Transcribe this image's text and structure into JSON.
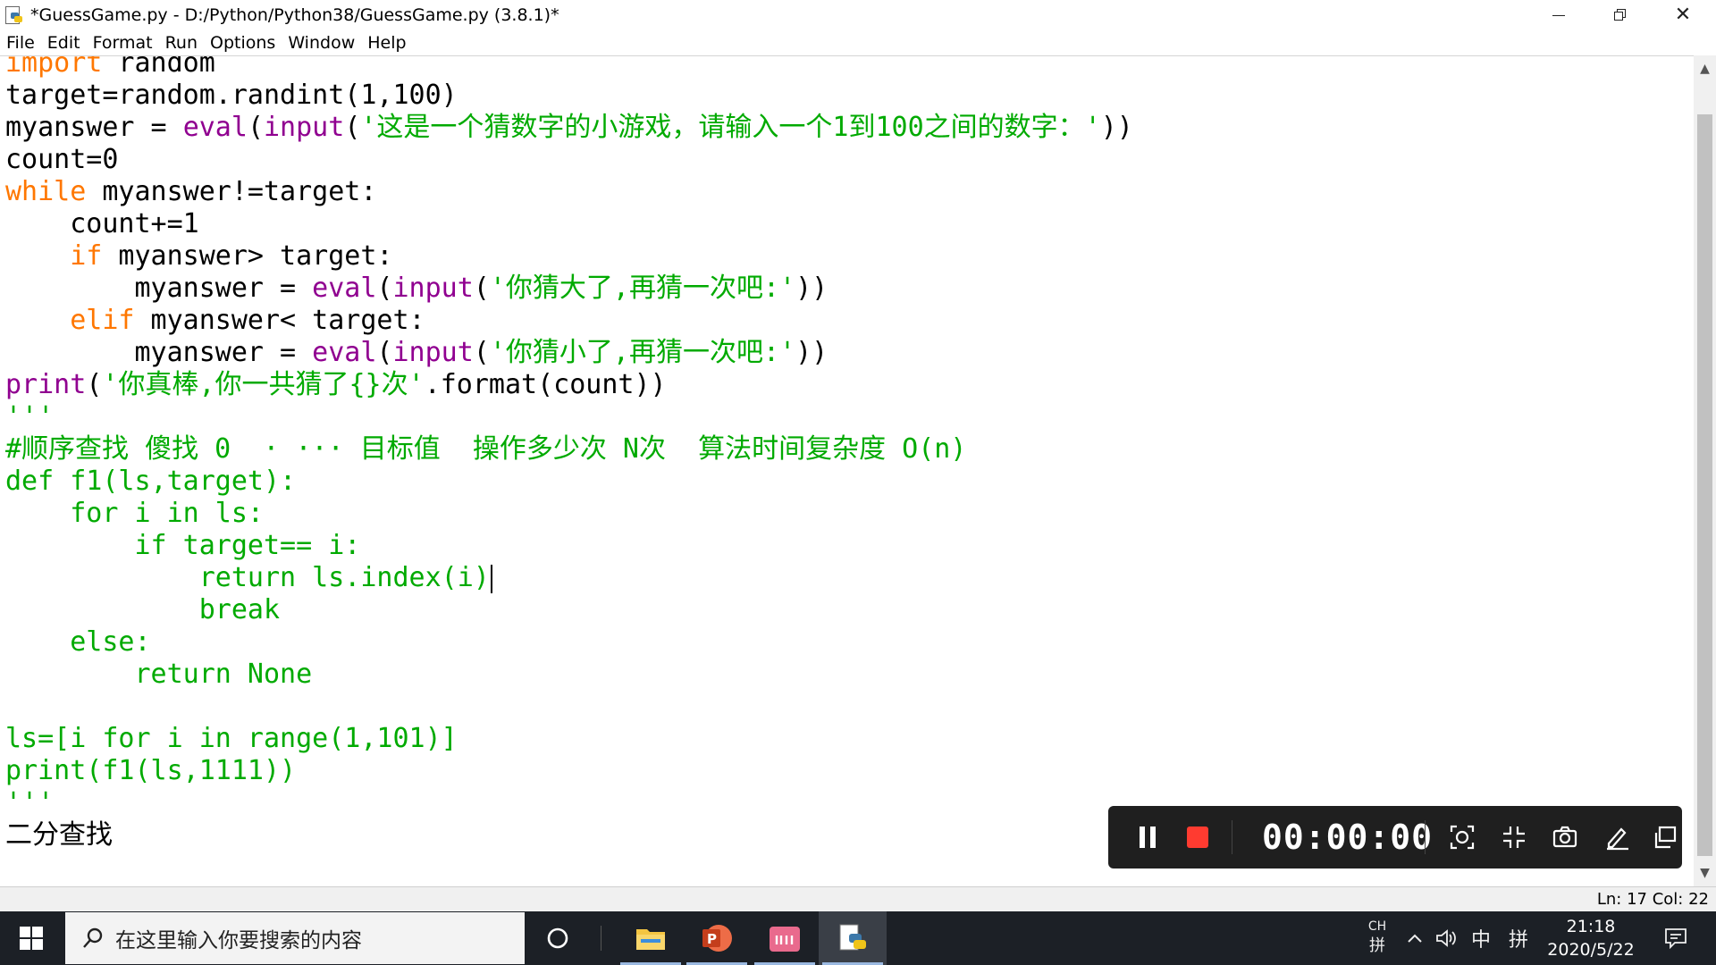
{
  "window": {
    "title": "*GuessGame.py - D:/Python/Python38/GuessGame.py (3.8.1)*"
  },
  "menu": [
    "File",
    "Edit",
    "Format",
    "Run",
    "Options",
    "Window",
    "Help"
  ],
  "code": [
    [
      {
        "t": "import",
        "c": "kw"
      },
      {
        "t": " random",
        "c": "plain"
      }
    ],
    [
      {
        "t": "target=random.randint(1,100)",
        "c": "plain"
      }
    ],
    [
      {
        "t": "myanswer = ",
        "c": "plain"
      },
      {
        "t": "eval",
        "c": "bi"
      },
      {
        "t": "(",
        "c": "plain"
      },
      {
        "t": "input",
        "c": "bi"
      },
      {
        "t": "(",
        "c": "plain"
      },
      {
        "t": "'这是一个猜数字的小游戏，请输入一个1到100之间的数字：'",
        "c": "str"
      },
      {
        "t": "))",
        "c": "plain"
      }
    ],
    [
      {
        "t": "count=0",
        "c": "plain"
      }
    ],
    [
      {
        "t": "while",
        "c": "kw"
      },
      {
        "t": " myanswer!=target:",
        "c": "plain"
      }
    ],
    [
      {
        "t": "    count+=1",
        "c": "plain"
      }
    ],
    [
      {
        "t": "    ",
        "c": "plain"
      },
      {
        "t": "if",
        "c": "kw"
      },
      {
        "t": " myanswer> target:",
        "c": "plain"
      }
    ],
    [
      {
        "t": "        myanswer = ",
        "c": "plain"
      },
      {
        "t": "eval",
        "c": "bi"
      },
      {
        "t": "(",
        "c": "plain"
      },
      {
        "t": "input",
        "c": "bi"
      },
      {
        "t": "(",
        "c": "plain"
      },
      {
        "t": "'你猜大了,再猜一次吧:'",
        "c": "str"
      },
      {
        "t": "))",
        "c": "plain"
      }
    ],
    [
      {
        "t": "    ",
        "c": "plain"
      },
      {
        "t": "elif",
        "c": "kw"
      },
      {
        "t": " myanswer< target:",
        "c": "plain"
      }
    ],
    [
      {
        "t": "        myanswer = ",
        "c": "plain"
      },
      {
        "t": "eval",
        "c": "bi"
      },
      {
        "t": "(",
        "c": "plain"
      },
      {
        "t": "input",
        "c": "bi"
      },
      {
        "t": "(",
        "c": "plain"
      },
      {
        "t": "'你猜小了,再猜一次吧:'",
        "c": "str"
      },
      {
        "t": "))",
        "c": "plain"
      }
    ],
    [
      {
        "t": "print",
        "c": "bi"
      },
      {
        "t": "(",
        "c": "plain"
      },
      {
        "t": "'你真棒,你一共猜了{}次'",
        "c": "str"
      },
      {
        "t": ".format(count))",
        "c": "plain"
      }
    ],
    [
      {
        "t": "'''",
        "c": "green"
      }
    ],
    [
      {
        "t": "#顺序查找 傻找 0  · ··· 目标值  操作多少次 N次  算法时间复杂度 O(n)",
        "c": "green"
      }
    ],
    [
      {
        "t": "def f1(ls,target):",
        "c": "green"
      }
    ],
    [
      {
        "t": "    for i in ls:",
        "c": "green"
      }
    ],
    [
      {
        "t": "        if target== i:",
        "c": "green"
      }
    ],
    [
      {
        "t": "            return ls.index(i)",
        "c": "green"
      }
    ],
    [
      {
        "t": "            break",
        "c": "green"
      }
    ],
    [
      {
        "t": "    else:",
        "c": "green"
      }
    ],
    [
      {
        "t": "        return None",
        "c": "green"
      }
    ],
    [
      {
        "t": "",
        "c": "plain"
      }
    ],
    [
      {
        "t": "ls=[i for i in range(1,101)]",
        "c": "green"
      }
    ],
    [
      {
        "t": "print(f1(ls,1111))",
        "c": "green"
      }
    ],
    [
      {
        "t": "'''",
        "c": "green"
      }
    ],
    [
      {
        "t": "二分查找",
        "c": "plain"
      }
    ]
  ],
  "cursor_line": 16,
  "status": {
    "position": "Ln: 17  Col: 22"
  },
  "recorder": {
    "timer": "00:00:00"
  },
  "taskbar": {
    "search_placeholder": "在这里输入你要搜索的内容",
    "apps": [
      "file-explorer",
      "powerpoint",
      "bilibili",
      "python-idle"
    ],
    "tray_lang": "CH",
    "tray_ime_mode": "中",
    "tray_ime": "拼",
    "time": "21:18",
    "date": "2020/5/22"
  },
  "colors": {
    "keyword": "#ff7700",
    "builtin": "#900090",
    "string": "#00aa00",
    "recorder_bg": "#1f1f1f",
    "stop_red": "#ff3b30",
    "taskbar_bg": "#1c2026"
  }
}
